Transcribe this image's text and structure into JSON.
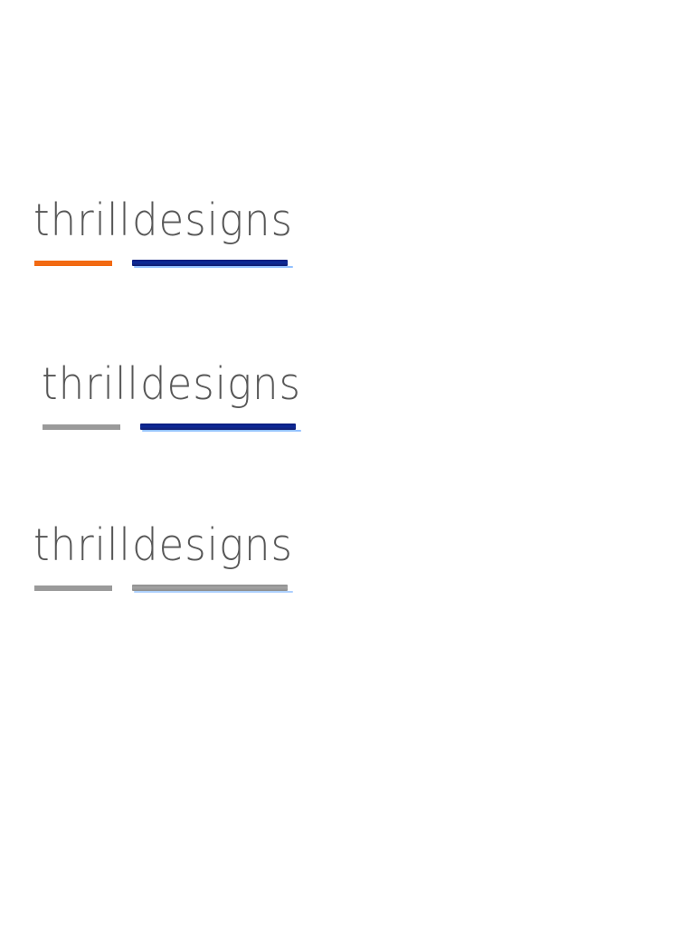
{
  "logos": [
    {
      "word1": "thrill",
      "word2": "designs",
      "underline1_color": "#f26a12",
      "underline2_color": "#0d2288",
      "variant": "orange-navy"
    },
    {
      "word1": "thrill",
      "word2": "designs",
      "underline1_color": "#9a9a9a",
      "underline2_color": "#0d2288",
      "variant": "grey-navy"
    },
    {
      "word1": "thrill",
      "word2": "designs",
      "underline1_color": "#9a9a9a",
      "underline2_color": "#9a9a9a",
      "variant": "grey-grey"
    }
  ],
  "text_color": "#575757",
  "background_color": "#ffffff"
}
